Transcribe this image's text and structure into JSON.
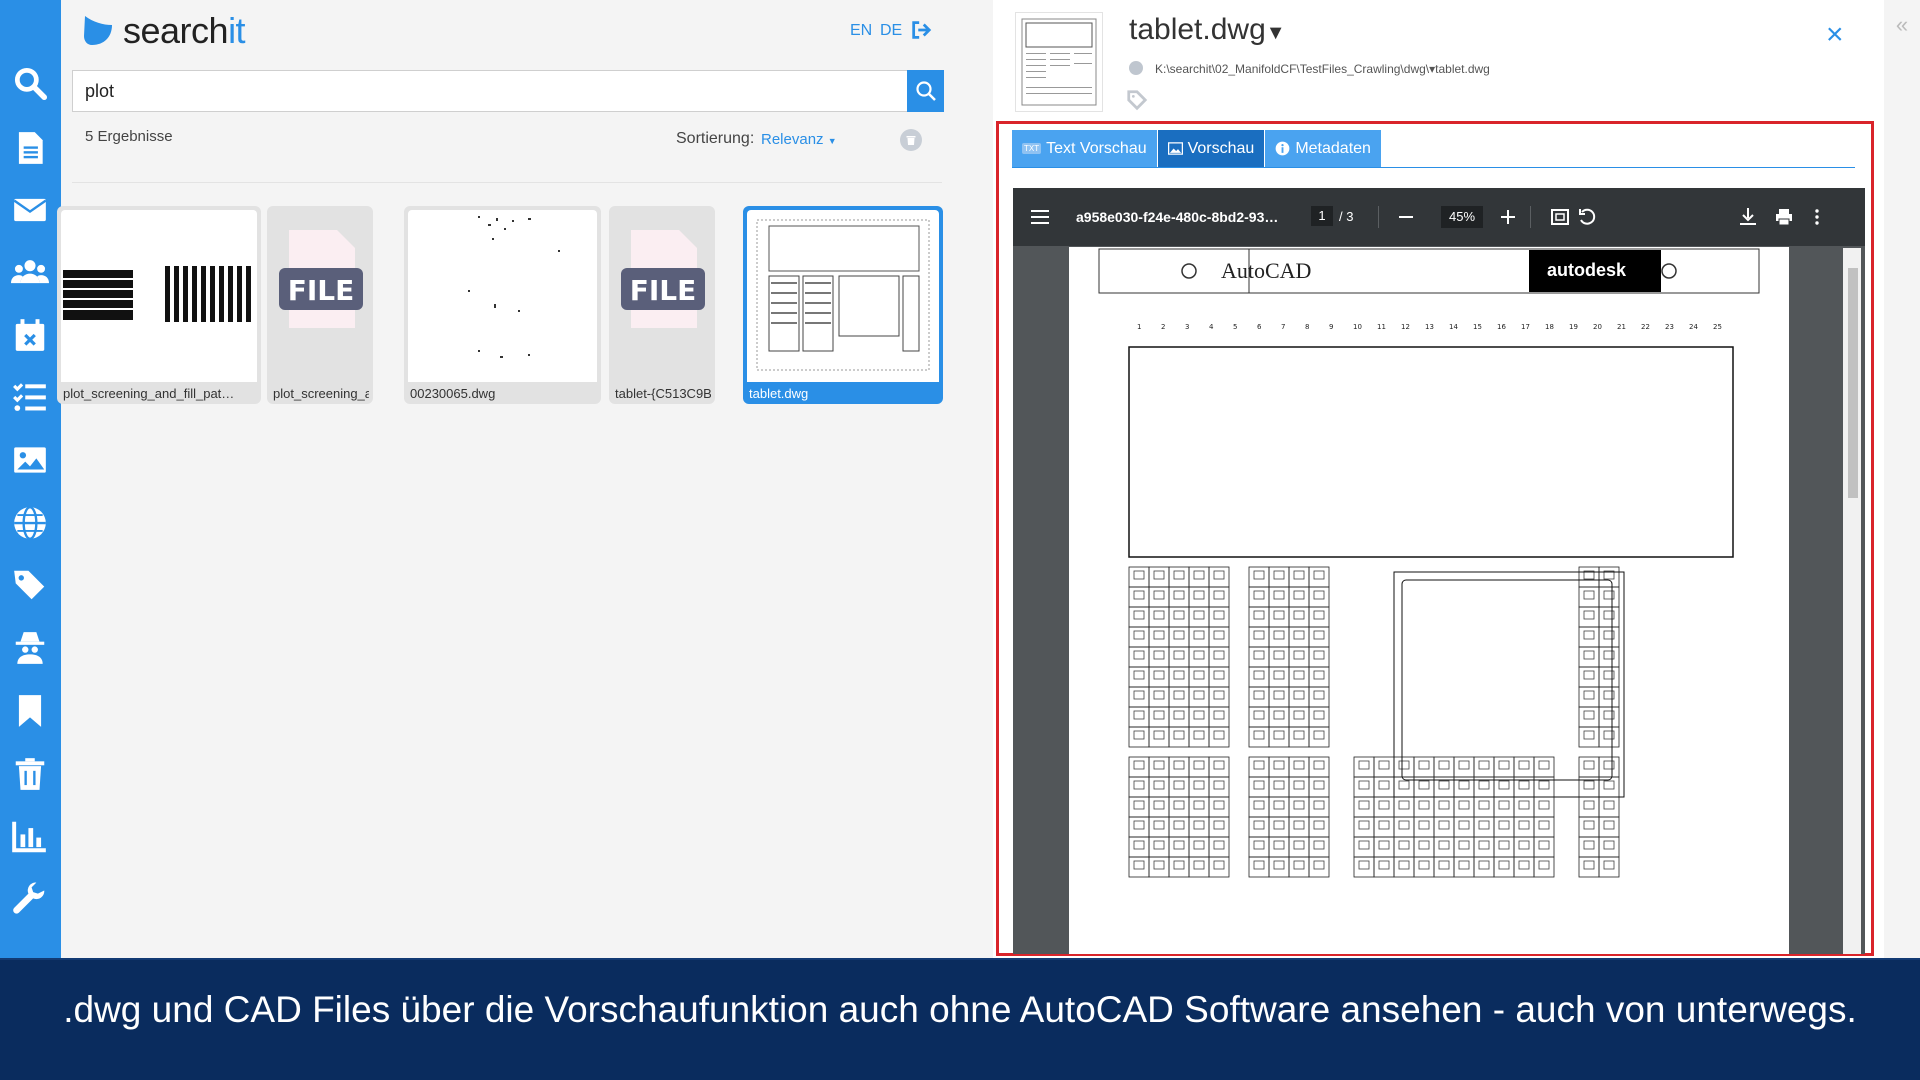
{
  "app": {
    "logo_primary": "search",
    "logo_accent": "it",
    "accent_color": "#2a8fe6",
    "lang_en": "EN",
    "lang_de": "DE"
  },
  "sidebar": {
    "items": [
      {
        "icon": "search-icon"
      },
      {
        "icon": "document-icon"
      },
      {
        "icon": "mail-icon"
      },
      {
        "icon": "users-icon"
      },
      {
        "icon": "calendar-icon"
      },
      {
        "icon": "tasks-icon"
      },
      {
        "icon": "image-icon"
      },
      {
        "icon": "globe-icon"
      },
      {
        "icon": "tags-icon"
      },
      {
        "icon": "spy-icon"
      },
      {
        "icon": "bookmark-icon"
      },
      {
        "icon": "trash-icon"
      },
      {
        "icon": "chart-icon"
      },
      {
        "icon": "wrench-icon"
      }
    ]
  },
  "search": {
    "query": "plot",
    "results_count": "5 Ergebnisse",
    "sort_label": "Sortierung:",
    "sort_value": "Relevanz"
  },
  "results": [
    {
      "caption": "plot_screening_and_fill_pat…",
      "thumb": "hatch"
    },
    {
      "caption": "plot_screening_a…",
      "thumb": "file"
    },
    {
      "caption": "00230065.dwg",
      "thumb": "dots"
    },
    {
      "caption": "tablet-{C513C9B…",
      "thumb": "file"
    },
    {
      "caption": "tablet.dwg",
      "thumb": "tablet",
      "selected": true
    }
  ],
  "file_badge": "FILE",
  "preview": {
    "title": "tablet.dwg",
    "path": "K:\\searchit\\02_ManifoldCF\\TestFiles_Crawling\\dwg\\▾tablet.dwg",
    "close": "×",
    "tabs": [
      {
        "label": "Text Vorschau",
        "icon": "TXT"
      },
      {
        "label": "Vorschau",
        "icon": "image-icon"
      },
      {
        "label": "Metadaten",
        "icon": "info-icon"
      }
    ]
  },
  "viewer": {
    "doc_title": "a958e030-f24e-480c-8bd2-93…",
    "page": "1",
    "total": "/ 3",
    "zoom": "45%",
    "header_left": "AutoCAD",
    "header_right": "autodesk"
  },
  "caption": ".dwg und CAD Files über die Vorschaufunktion auch ohne AutoCAD Software ansehen - auch von unterwegs."
}
